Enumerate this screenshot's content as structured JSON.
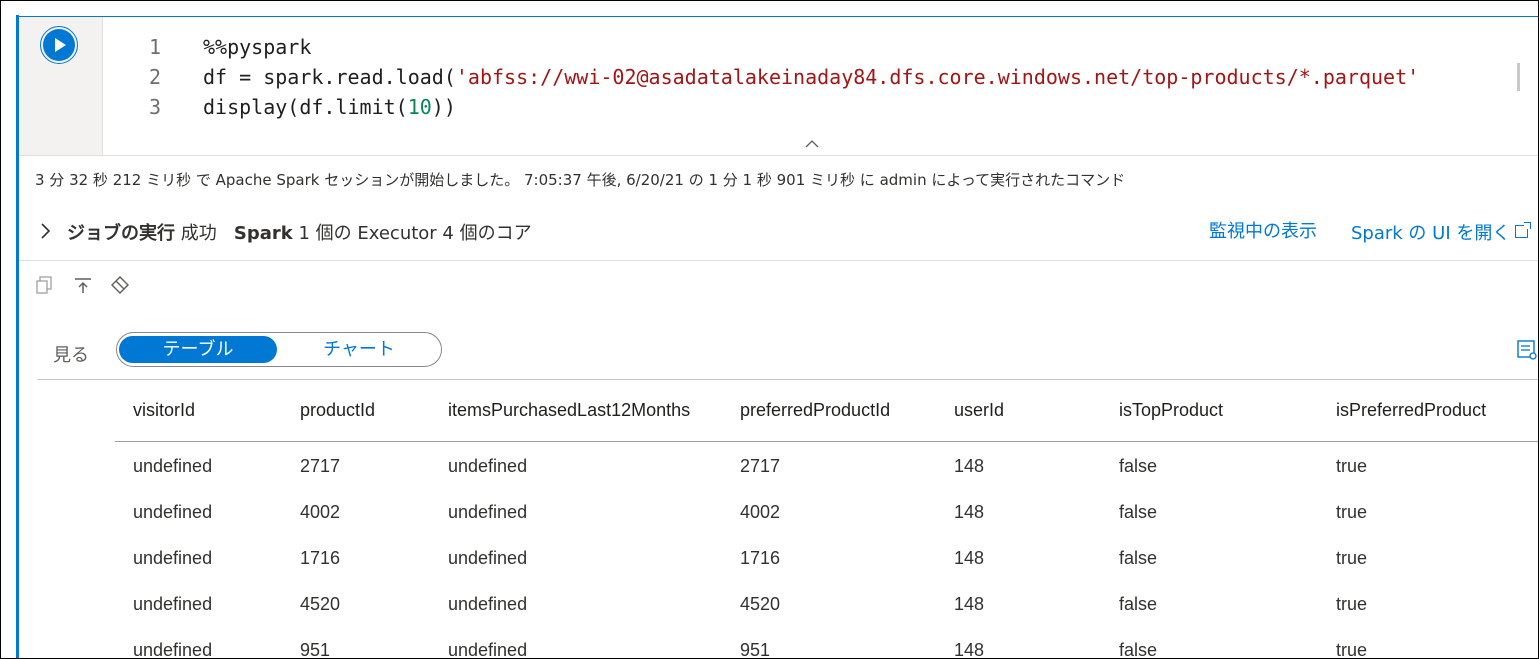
{
  "code": {
    "lines": [
      {
        "num": "1",
        "text": "%%pyspark"
      },
      {
        "num": "2",
        "pre": "df = spark.read.load(",
        "str": "'abfss://wwi-02@asadatalakeinaday84.dfs.core.windows.net/top-products/*.parquet'"
      },
      {
        "num": "3",
        "pre": "display(df.limit(",
        "num_arg": "10",
        "post": "))"
      }
    ]
  },
  "exec_info": "3 分 32 秒 212 ミリ秒 で Apache Spark セッションが開始しました。 7:05:37 午後, 6/20/21 の 1 分 1 秒 901 ミリ秒 に admin によって実行されたコマンド",
  "job": {
    "title": "ジョブの実行",
    "status": "成功",
    "spark_label": "Spark",
    "detail": "1 個の Executor 4 個のコア",
    "monitor_link": "監視中の表示",
    "spark_ui_link": "Spark の UI を開く"
  },
  "view": {
    "label": "見る",
    "options": [
      "テーブル",
      "チャート"
    ],
    "selected": "テーブル"
  },
  "table": {
    "columns": [
      "visitorId",
      "productId",
      "itemsPurchasedLast12Months",
      "preferredProductId",
      "userId",
      "isTopProduct",
      "isPreferredProduct"
    ],
    "rows": [
      [
        "undefined",
        "2717",
        "undefined",
        "2717",
        "148",
        "false",
        "true"
      ],
      [
        "undefined",
        "4002",
        "undefined",
        "4002",
        "148",
        "false",
        "true"
      ],
      [
        "undefined",
        "1716",
        "undefined",
        "1716",
        "148",
        "false",
        "true"
      ],
      [
        "undefined",
        "4520",
        "undefined",
        "4520",
        "148",
        "false",
        "true"
      ],
      [
        "undefined",
        "951",
        "undefined",
        "951",
        "148",
        "false",
        "true"
      ]
    ]
  },
  "colors": {
    "accent": "#0078d4",
    "string": "#a31515",
    "number": "#098658"
  }
}
